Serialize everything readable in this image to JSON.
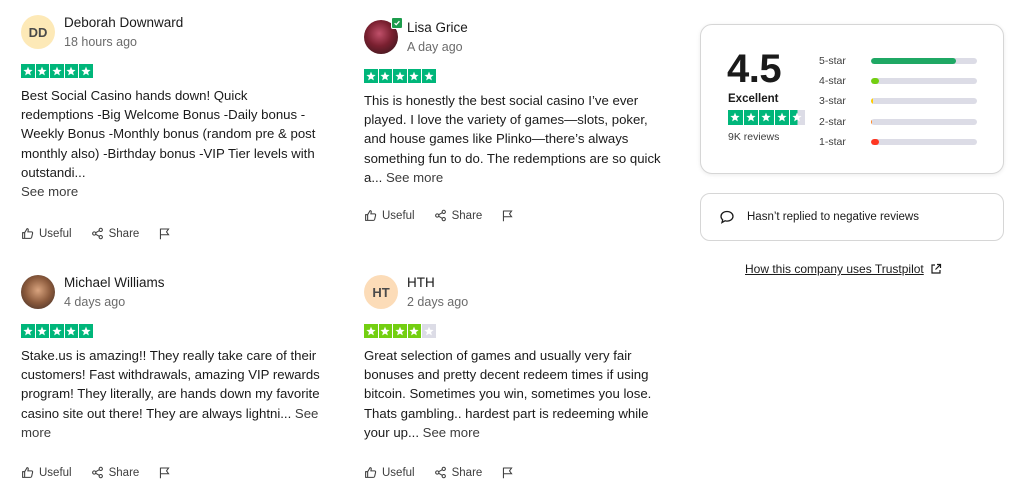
{
  "reviews": [
    {
      "initials": "DD",
      "avatar_color": "#fde9b7",
      "name": "Deborah Downward",
      "date": "18 hours ago",
      "rating": 5,
      "text": "Best Social Casino hands down! Quick redemptions -Big Welcome Bonus -Daily bonus -Weekly Bonus -Monthly bonus (random pre & post monthly also) -Birthday bonus -VIP Tier levels with outstandi...",
      "see_more": "See more"
    },
    {
      "name": "Lisa Grice",
      "date": "A day ago",
      "rating": 5,
      "text": "This is honestly the best social casino I’ve ever played. I love the variety of games—slots, poker, and house games like Plinko—there’s always something fun to do. The redemptions are so quick a...",
      "see_more": "See more"
    },
    {
      "name": "Michael Williams",
      "date": "4 days ago",
      "rating": 5,
      "text": "Stake.us is amazing!! They really take care of their customers! Fast withdrawals, amazing VIP rewards program! They literally, are hands down my favorite casino site out there! They are always lightni...",
      "see_more": "See more"
    },
    {
      "initials": "HT",
      "avatar_color": "#fcdcb8",
      "name": "HTH",
      "date": "2 days ago",
      "rating": 4,
      "text": "Great selection of games and usually very fair bonuses and pretty decent redeem times if using bitcoin. Sometimes you win, sometimes you lose. Thats gambling.. hardest part is redeeming while your up...",
      "see_more": "See more"
    }
  ],
  "actions": {
    "useful": "Useful",
    "share": "Share"
  },
  "summary": {
    "score": "4.5",
    "label": "Excellent",
    "rating_stars": 4.5,
    "reviews_count": "9K reviews",
    "distribution": [
      {
        "label": "5-star",
        "fraction": 0.8,
        "color": "#1fa864"
      },
      {
        "label": "4-star",
        "fraction": 0.08,
        "color": "#73cf11"
      },
      {
        "label": "3-star",
        "fraction": 0.02,
        "color": "#ffce00"
      },
      {
        "label": "2-star",
        "fraction": 0.01,
        "color": "#ff8622"
      },
      {
        "label": "1-star",
        "fraction": 0.08,
        "color": "#ff3722"
      }
    ]
  },
  "reply_notice": "Hasn’t replied to negative reviews",
  "company_link": "How this company uses Trustpilot",
  "colors": {
    "star_green": "#00b67a",
    "star_light_green": "#73cf11",
    "star_empty": "#dcdce6"
  }
}
